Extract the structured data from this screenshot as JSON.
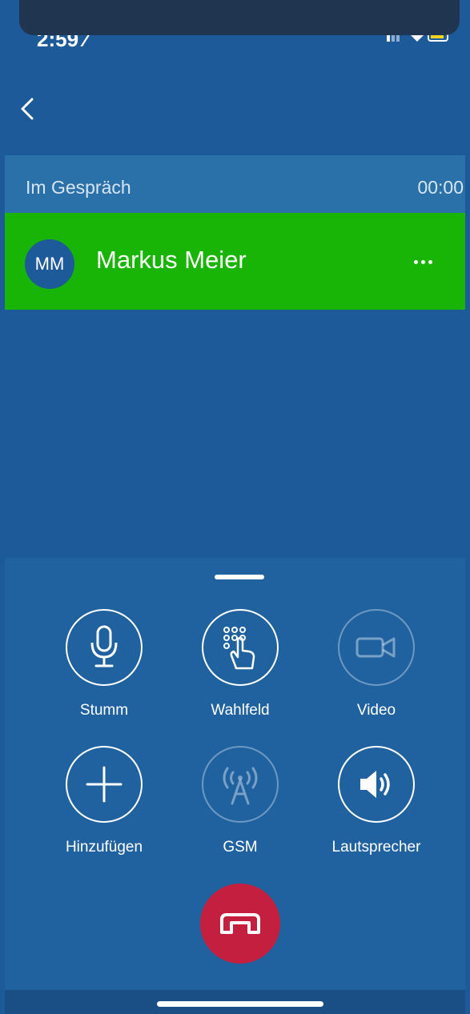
{
  "status_bar": {
    "time": "2:59 ⁄"
  },
  "header": {
    "back_icon": "chevron-left-icon"
  },
  "call": {
    "status_text": "Im Gespräch",
    "timer": "00:00",
    "caller_initials": "MM",
    "caller_name": "Markus Meier",
    "more_icon": "more-horizontal-icon"
  },
  "controls": [
    {
      "label": "Stumm",
      "icon": "microphone-icon"
    },
    {
      "label": "Wahlfeld",
      "icon": "dialpad-icon"
    },
    {
      "label": "Video",
      "icon": "video-camera-icon"
    },
    {
      "label": "Hinzufügen",
      "icon": "plus-icon"
    },
    {
      "label": "GSM",
      "icon": "antenna-icon"
    },
    {
      "label": "Lautsprecher",
      "icon": "speaker-icon"
    }
  ],
  "hangup": {
    "icon": "hang-up-icon"
  },
  "colors": {
    "background": "#1d5a99",
    "call_bar": "#2a71aa",
    "active_caller": "#18b406",
    "panel": "#2062a0",
    "hangup": "#c41f3e"
  }
}
